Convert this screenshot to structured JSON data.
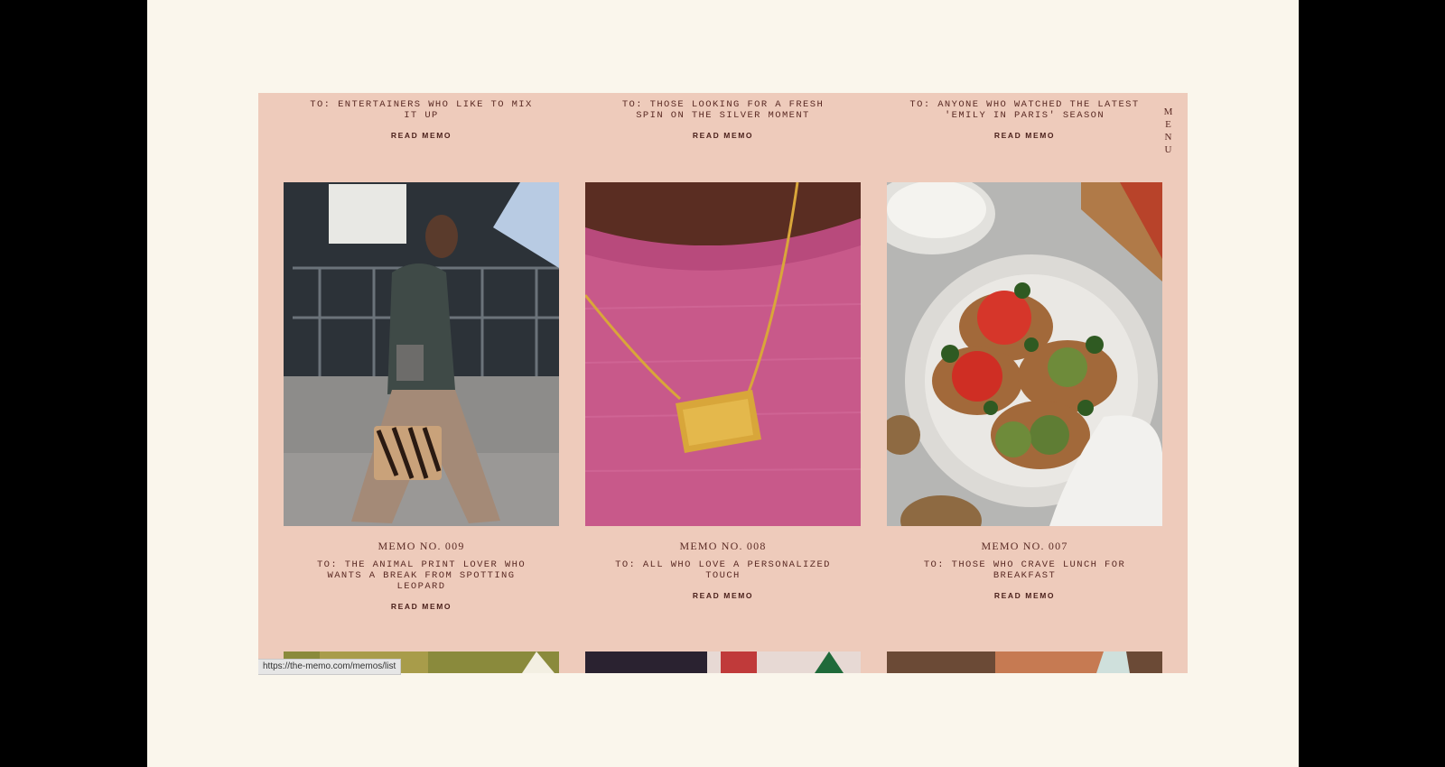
{
  "status_url": "https://the-memo.com/memos/list",
  "menu": {
    "letters": [
      "M",
      "E",
      "N",
      "U"
    ]
  },
  "read_label": "READ MEMO",
  "top_row": [
    {
      "to": "TO: ENTERTAINERS WHO LIKE TO MIX IT UP"
    },
    {
      "to": "TO: THOSE LOOKING FOR A FRESH SPIN ON THE SILVER MOMENT"
    },
    {
      "to": "TO: ANYONE WHO WATCHED THE LATEST 'EMILY IN PARIS' SEASON"
    }
  ],
  "memos": [
    {
      "number": "MEMO NO. 009",
      "to": "TO: THE ANIMAL PRINT LOVER WHO WANTS A BREAK FROM SPOTTING LEOPARD",
      "image": "street-style-zebra-bag",
      "accent": "#b8cbe3"
    },
    {
      "number": "MEMO NO. 008",
      "to": "TO: ALL WHO LOVE A PERSONALIZED TOUCH",
      "image": "gold-necklace-pink-sweater",
      "accent": "#d86a94"
    },
    {
      "number": "MEMO NO. 007",
      "to": "TO: THOSE WHO CRAVE LUNCH FOR BREAKFAST",
      "image": "tomato-toast-plate",
      "accent": "#b8432a"
    }
  ],
  "colors": {
    "panel": "#eecbbb",
    "text": "#5a2a24",
    "page": "#faf6ec"
  }
}
